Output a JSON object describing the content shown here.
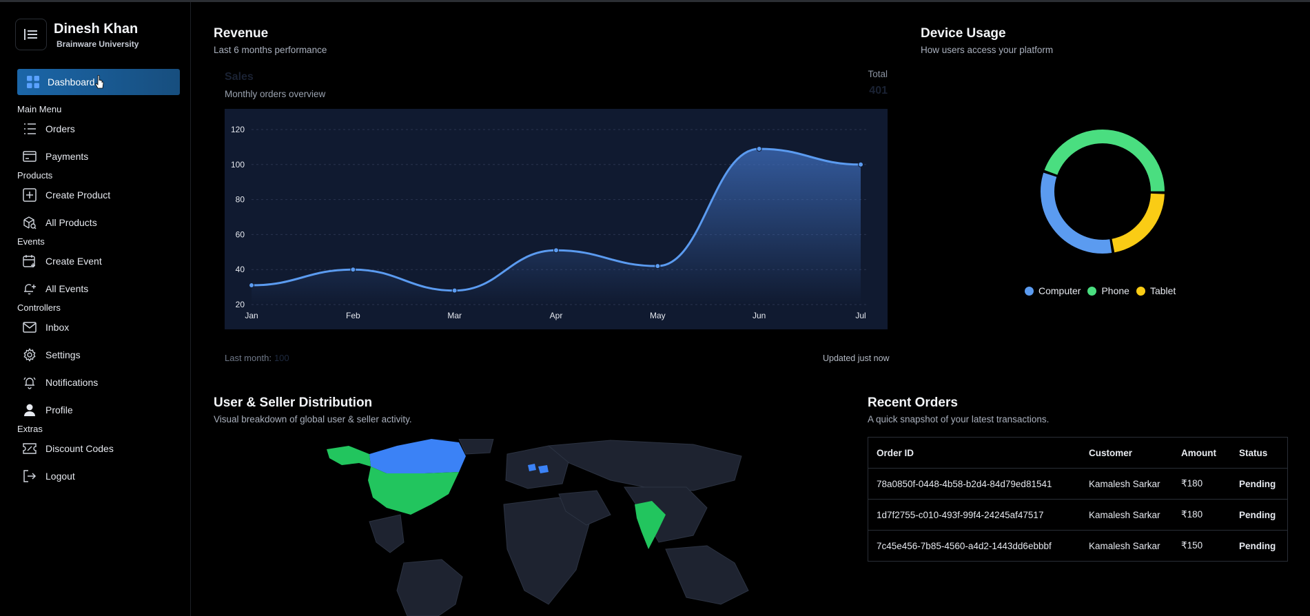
{
  "user": {
    "name": "Dinesh Khan",
    "org": "Brainware University"
  },
  "nav": {
    "active": {
      "label": "Dashboard",
      "icon": "grid-icon"
    },
    "sections": {
      "main": "Main Menu",
      "products": "Products",
      "events": "Events",
      "controllers": "Controllers",
      "extras": "Extras"
    },
    "items": [
      {
        "label": "Orders",
        "icon": "list-icon"
      },
      {
        "label": "Payments",
        "icon": "credit-card-icon"
      },
      {
        "label": "Create Product",
        "icon": "plus-square-icon"
      },
      {
        "label": "All Products",
        "icon": "box-search-icon"
      },
      {
        "label": "Create Event",
        "icon": "calendar-plus-icon"
      },
      {
        "label": "All Events",
        "icon": "bell-plus-icon"
      },
      {
        "label": "Inbox",
        "icon": "mail-icon"
      },
      {
        "label": "Settings",
        "icon": "gear-icon"
      },
      {
        "label": "Notifications",
        "icon": "bell-icon"
      },
      {
        "label": "Profile",
        "icon": "user-icon"
      },
      {
        "label": "Discount Codes",
        "icon": "ticket-icon"
      },
      {
        "label": "Logout",
        "icon": "logout-icon"
      }
    ]
  },
  "revenue": {
    "title": "Revenue",
    "subtitle": "Last 6 months performance",
    "card_title": "Sales",
    "card_subtitle": "Monthly orders overview",
    "total_label": "Total",
    "total_value": "401",
    "last_month_label": "Last month:",
    "last_month_value": "100",
    "updated": "Updated just now"
  },
  "device": {
    "title": "Device Usage",
    "subtitle": "How users access your platform",
    "legend": [
      "Computer",
      "Phone",
      "Tablet"
    ]
  },
  "distribution": {
    "title": "User & Seller Distribution",
    "subtitle": "Visual breakdown of global user & seller activity."
  },
  "orders": {
    "title": "Recent Orders",
    "subtitle": "A quick snapshot of your latest transactions.",
    "columns": [
      "Order ID",
      "Customer",
      "Amount",
      "Status"
    ],
    "rows": [
      [
        "78a0850f-0448-4b58-b2d4-84d79ed81541",
        "Kamalesh Sarkar",
        "₹180",
        "Pending"
      ],
      [
        "1d7f2755-c010-493f-99f4-24245af47517",
        "Kamalesh Sarkar",
        "₹180",
        "Pending"
      ],
      [
        "7c45e456-7b85-4560-a4d2-1443dd6ebbbf",
        "Kamalesh Sarkar",
        "₹150",
        "Pending"
      ]
    ]
  },
  "colors": {
    "accent": "#1b66a8",
    "line": "#5b9bf0",
    "computer": "#5b9bf0",
    "phone": "#4ade80",
    "tablet": "#facc15",
    "map_blue": "#3b82f6",
    "map_green": "#22c55e",
    "pending": "#f5b731"
  },
  "chart_data": [
    {
      "type": "area",
      "categories": [
        "Jan",
        "Feb",
        "Mar",
        "Apr",
        "May",
        "Jun",
        "Jul"
      ],
      "values": [
        31,
        40,
        28,
        51,
        42,
        109,
        100
      ],
      "ylim": [
        20,
        120
      ],
      "yticks": [
        20,
        40,
        60,
        80,
        100,
        120
      ],
      "grid": true
    },
    {
      "type": "pie",
      "categories": [
        "Computer",
        "Phone",
        "Tablet"
      ],
      "values": [
        33,
        45,
        22
      ],
      "legend": "bottom"
    }
  ]
}
